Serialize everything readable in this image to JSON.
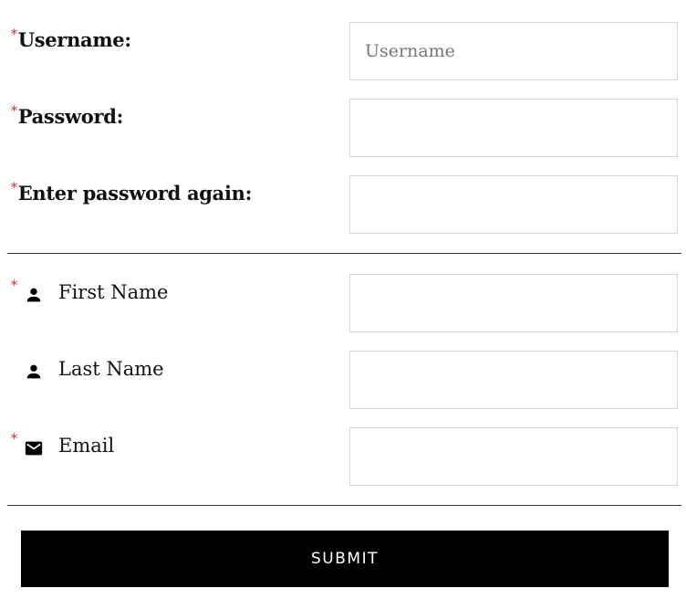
{
  "account": {
    "username": {
      "label": "Username:",
      "required_mark": "*",
      "placeholder": "Username",
      "value": ""
    },
    "password": {
      "label": "Password:",
      "required_mark": "*",
      "placeholder": "",
      "value": ""
    },
    "password_again": {
      "label": "Enter password again:",
      "required_mark": "*",
      "placeholder": "",
      "value": ""
    }
  },
  "profile": {
    "first_name": {
      "label": "First Name",
      "required_mark": "*",
      "icon": "person-icon",
      "value": ""
    },
    "last_name": {
      "label": "Last Name",
      "required_mark": "",
      "icon": "person-icon",
      "value": ""
    },
    "email": {
      "label": "Email",
      "required_mark": "*",
      "icon": "mail-icon",
      "value": ""
    }
  },
  "actions": {
    "submit_label": "SUBMIT"
  },
  "colors": {
    "required": "#e0202a",
    "button_bg": "#000000",
    "button_text": "#ffffff",
    "field_border": "#d6d6d6",
    "divider": "#333333"
  }
}
